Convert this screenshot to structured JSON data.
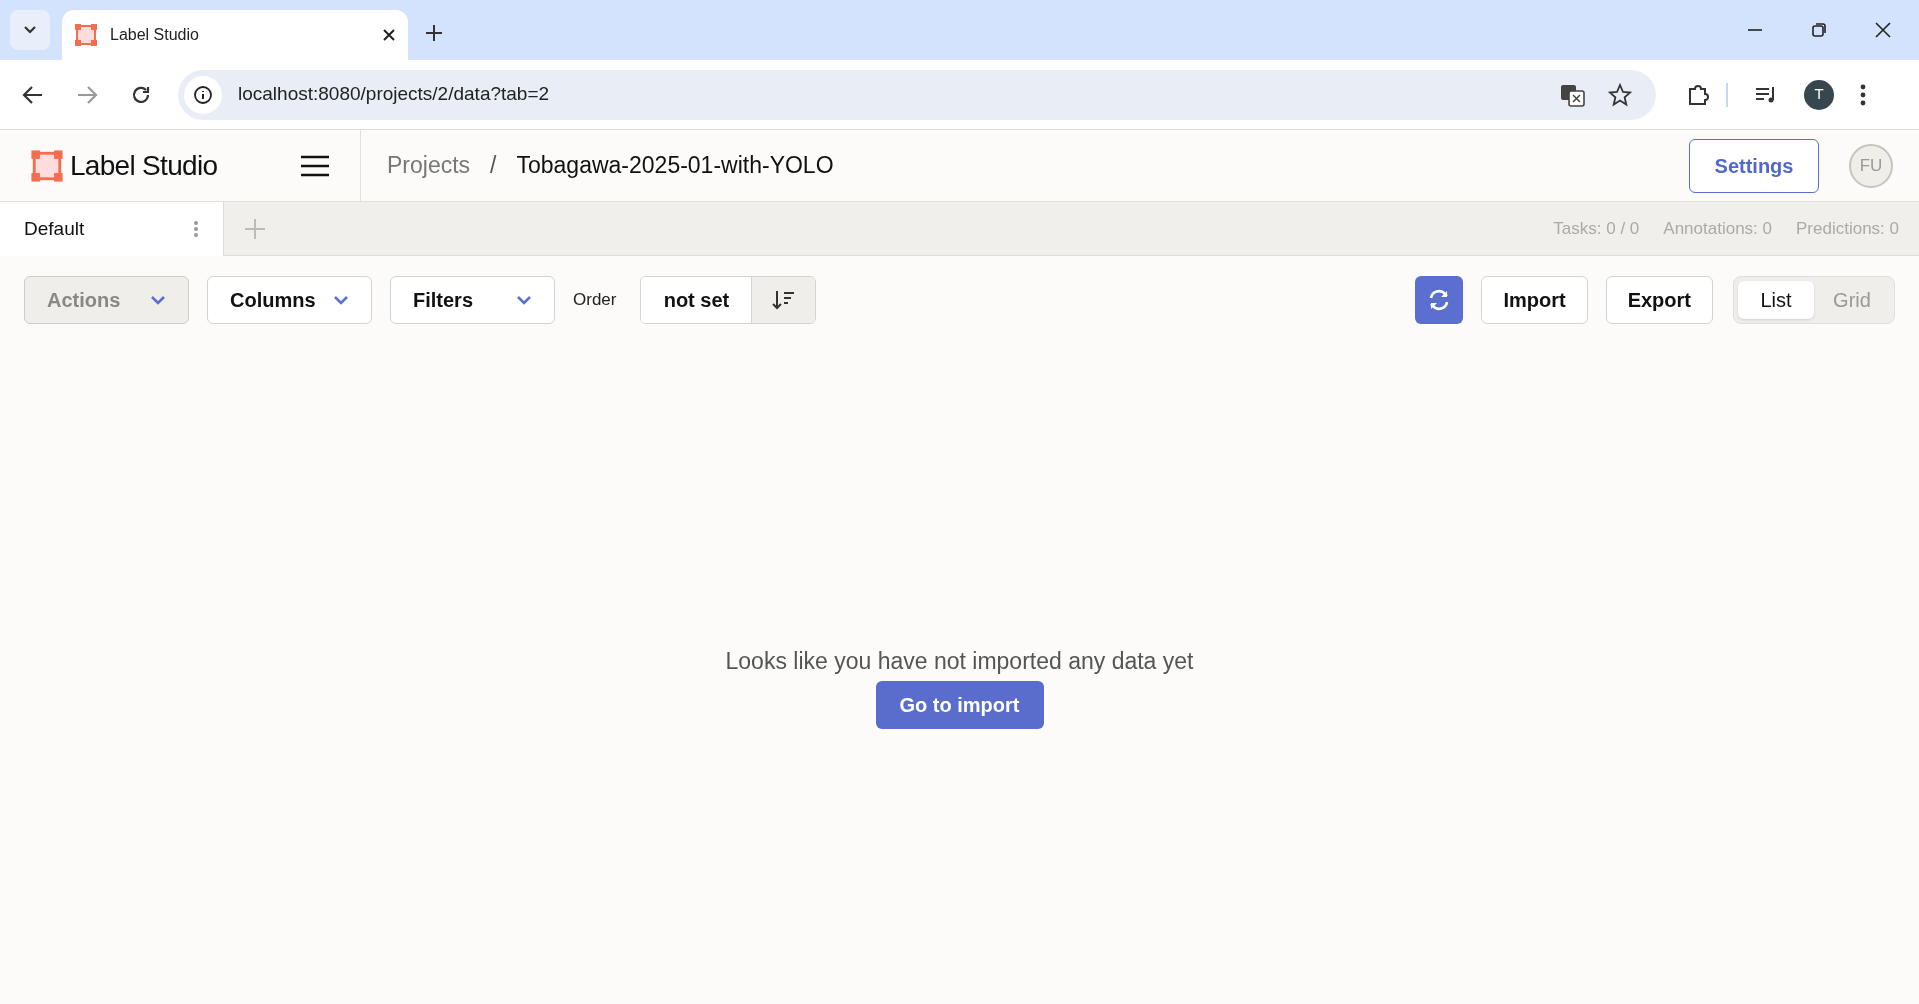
{
  "browser": {
    "tab_title": "Label Studio",
    "address": "localhost:8080/projects/2/data?tab=2",
    "profile_initial": "T"
  },
  "header": {
    "logo": "Label Studio",
    "breadcrumbs": [
      "Projects",
      "Tobagawa-2025-01-with-YOLO"
    ],
    "separator": "/",
    "settings": "Settings",
    "avatar": "FU"
  },
  "views": {
    "tabs": [
      {
        "label": "Default",
        "selected": true
      }
    ],
    "stats": [
      "Tasks: 0 / 0",
      "Annotations: 0",
      "Predictions: 0"
    ]
  },
  "toolbar": {
    "dropdowns": [
      {
        "label": "Actions",
        "disabled": true
      },
      {
        "label": "Columns",
        "disabled": false
      },
      {
        "label": "Filters",
        "disabled": false
      }
    ],
    "order_label": "Order",
    "order_value": "not set",
    "buttons": [
      "Import",
      "Export"
    ],
    "view_toggle": [
      {
        "label": "List",
        "selected": true
      },
      {
        "label": "Grid",
        "selected": false
      }
    ]
  },
  "empty": {
    "message": "Looks like you have not imported any data yet",
    "button": "Go to import"
  }
}
